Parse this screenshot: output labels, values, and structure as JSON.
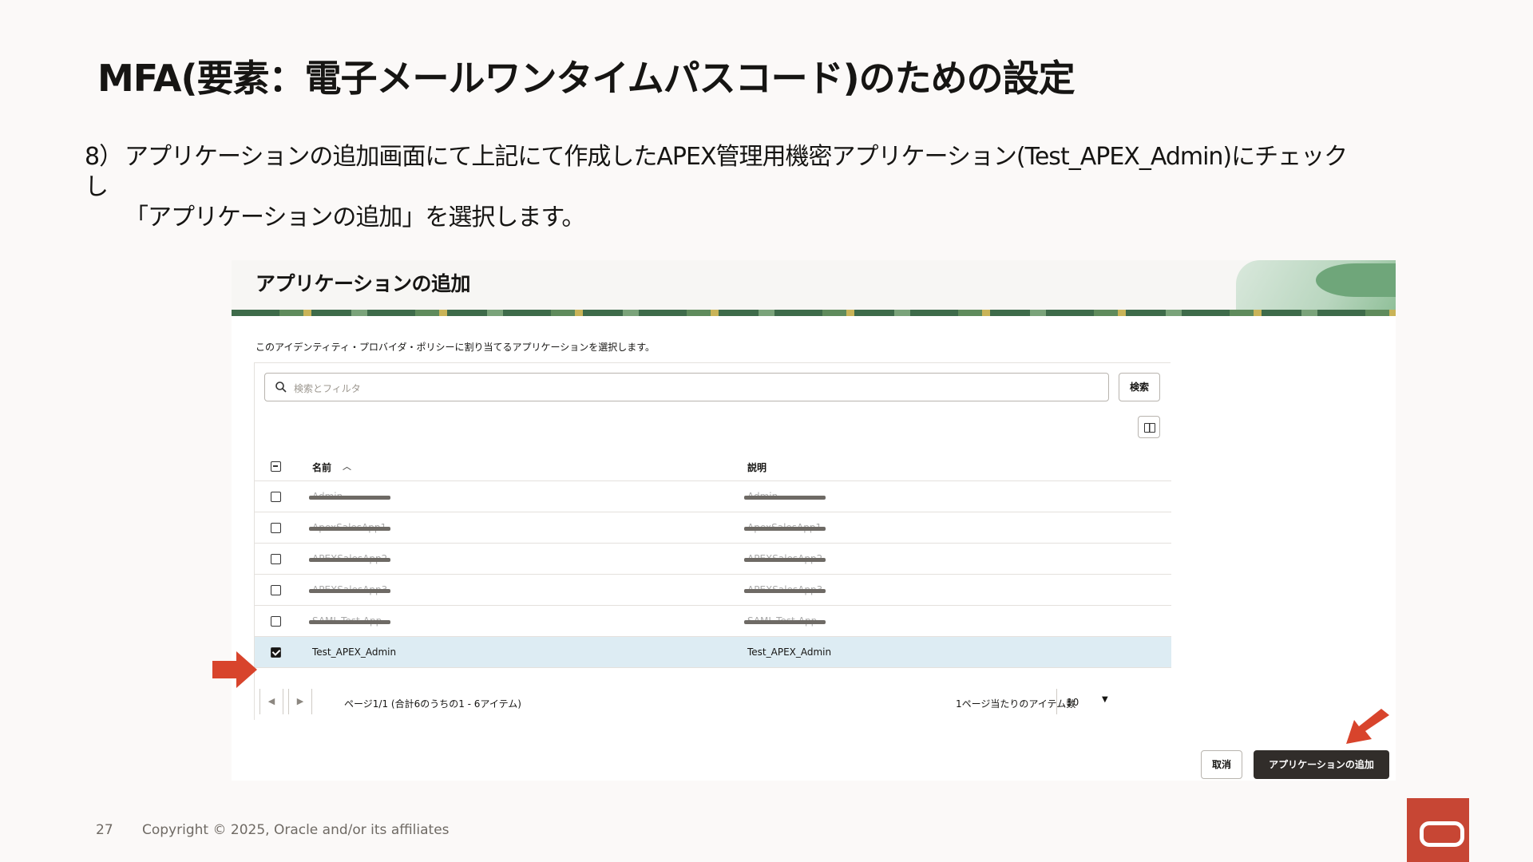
{
  "slide": {
    "title": "MFA(要素：電子メールワンタイムパスコード)のための設定",
    "step_number": "8）",
    "step_line1": "アプリケーションの追加画面にて上記にて作成したAPEX管理用機密アプリケーション(Test_APEX_Admin)にチェックし",
    "step_line2": "「アプリケーションの追加」を選択します。"
  },
  "dialog": {
    "title": "アプリケーションの追加",
    "intro": "このアイデンティティ・プロバイダ・ポリシーに割り当てるアプリケーションを選択します。",
    "search": {
      "placeholder": "検索とフィルタ",
      "button": "検索"
    },
    "table": {
      "col_name": "名前",
      "col_desc": "説明",
      "rows": [
        {
          "name": "Admin",
          "desc": "Admin",
          "checked": false,
          "redacted": true
        },
        {
          "name": "ApexSalesApp1",
          "desc": "ApexSalesApp1",
          "checked": false,
          "redacted": true
        },
        {
          "name": "APEXSalesApp2",
          "desc": "APEXSalesApp2",
          "checked": false,
          "redacted": true
        },
        {
          "name": "APEXSalesApp3",
          "desc": "APEXSalesApp3",
          "checked": false,
          "redacted": true
        },
        {
          "name": "SAML-Test-App",
          "desc": "SAML-Test-App",
          "checked": false,
          "redacted": true
        },
        {
          "name": "Test_APEX_Admin",
          "desc": "Test_APEX_Admin",
          "checked": true,
          "redacted": false
        }
      ]
    },
    "pager": {
      "prev": "◀",
      "next": "▶",
      "text": "ページ1/1 (合計6のうちの1 - 6アイテム)",
      "per_page_label": "1ページ当たりのアイテム数",
      "per_page_value": "10"
    },
    "cancel_button": "取消",
    "add_button": "アプリケーションの追加"
  },
  "footer": {
    "page_number": "27",
    "copyright": "Copyright © 2025, Oracle and/or its affiliates"
  },
  "colors": {
    "accent_red": "#c74634",
    "selected_row": "#ddecf3",
    "primary_button": "#312d2a"
  }
}
